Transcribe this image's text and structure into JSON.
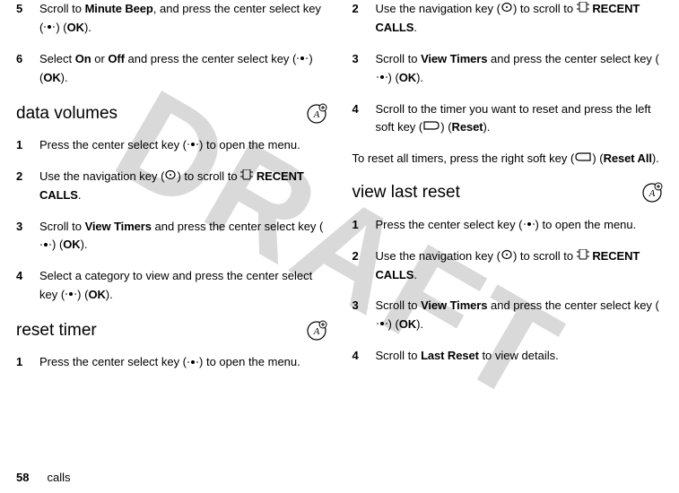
{
  "watermark": "DRAFT",
  "footer": {
    "page": "58",
    "section": "calls"
  },
  "left": {
    "step5": {
      "n": "5",
      "t1": "Scroll to ",
      "bold1": "Minute Beep",
      "t2": ", and press the center select key (",
      "t3": ") (",
      "bold2": "OK",
      "t4": ")."
    },
    "step6": {
      "n": "6",
      "t1": "Select ",
      "bold1": "On",
      "t2": " or ",
      "bold2": "Off",
      "t3": " and press the center select key (",
      "t4": ") (",
      "bold3": "OK",
      "t5": ")."
    },
    "h1": "data volumes",
    "dv": {
      "s1": {
        "n": "1",
        "t1": "Press the center select key (",
        "t2": ") to open the menu."
      },
      "s2": {
        "n": "2",
        "t1": "Use the navigation key (",
        "t2": ") to scroll to ",
        "bold1": "RECENT CALLS",
        "t3": "."
      },
      "s3": {
        "n": "3",
        "t1": "Scroll to ",
        "bold1": "View Timers",
        "t2": " and press the center select key (",
        "t3": ") (",
        "bold2": "OK",
        "t4": ")."
      },
      "s4": {
        "n": "4",
        "t1": "Select a category to view and press the center select key (",
        "t2": ") (",
        "bold1": "OK",
        "t3": ")."
      }
    },
    "h2": "reset timer",
    "rt": {
      "s1": {
        "n": "1",
        "t1": "Press the center select key (",
        "t2": ") to open the menu."
      }
    }
  },
  "right": {
    "s2": {
      "n": "2",
      "t1": "Use the navigation key (",
      "t2": ") to scroll to ",
      "bold1": "RECENT CALLS",
      "t3": "."
    },
    "s3": {
      "n": "3",
      "t1": "Scroll to ",
      "bold1": "View Timers",
      "t2": " and press the center select key (",
      "t3": ") (",
      "bold2": "OK",
      "t4": ")."
    },
    "s4": {
      "n": "4",
      "t1": "Scroll to the timer you want to reset and press the left soft key (",
      "t2": ") (",
      "bold1": "Reset",
      "t3": ")."
    },
    "para": {
      "t1": "To reset all timers, press the right soft key (",
      "t2": ") (",
      "bold1": "Reset All",
      "t3": ")."
    },
    "h1": "view last reset",
    "vlr": {
      "s1": {
        "n": "1",
        "t1": "Press the center select key (",
        "t2": ") to open the menu."
      },
      "s2": {
        "n": "2",
        "t1": "Use the navigation key (",
        "t2": ") to scroll to ",
        "bold1": "RECENT CALLS",
        "t3": "."
      },
      "s3": {
        "n": "3",
        "t1": "Scroll to ",
        "bold1": "View Timers",
        "t2": " and press the center select key (",
        "t3": ") (",
        "bold2": "OK",
        "t4": ")."
      },
      "s4": {
        "n": "4",
        "t1": "Scroll to ",
        "bold1": "Last Reset",
        "t2": " to view details."
      }
    }
  }
}
